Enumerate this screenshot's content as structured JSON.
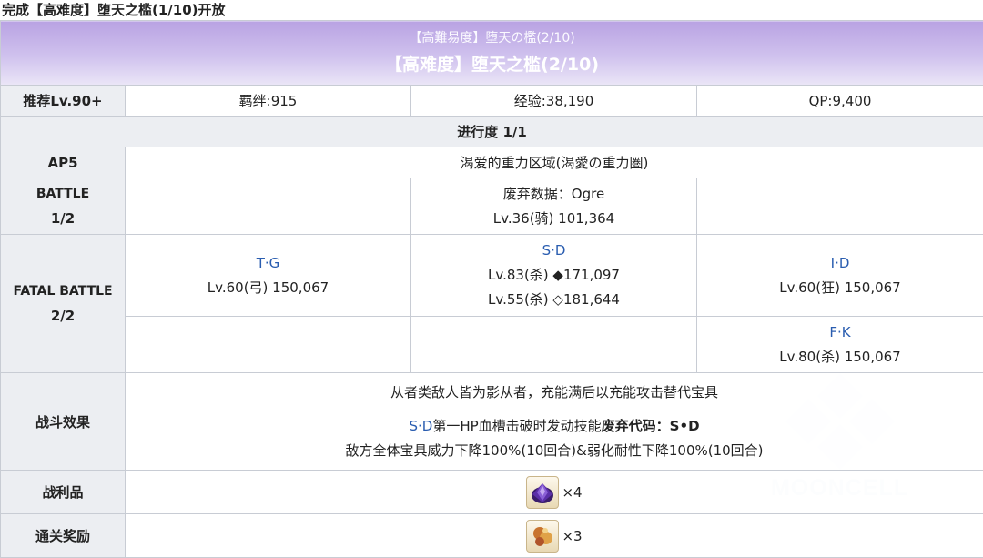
{
  "page_note": "完成【高难度】堕天之槛(1/10)开放",
  "quest": {
    "title_jp": "【高難易度】堕天の檻(2/10)",
    "title_cn": "【高难度】堕天之槛(2/10)",
    "recommend": "推荐Lv.90+",
    "bond": "羁绊:915",
    "exp": "经验:38,190",
    "qp": "QP:9,400",
    "progress": "进行度 1/1",
    "ap": "AP5",
    "field": "渴爱的重力区域(渴愛の重力圏)"
  },
  "battle1": {
    "label": "BATTLE",
    "index": "1/2",
    "enemy_name": "废弃数据：Ogre",
    "enemy_stats": "Lv.36(骑) 101,364"
  },
  "battle2": {
    "label": "FATAL BATTLE",
    "index": "2/2",
    "left_name": "T·G",
    "left_stats": "Lv.60(弓) 150,067",
    "mid_name": "S·D",
    "mid_stats_1": "Lv.83(杀) ◆171,097",
    "mid_stats_2": "Lv.55(杀) ◇181,644",
    "right_name": "I·D",
    "right_stats": "Lv.60(狂) 150,067",
    "right2_name": "F·K",
    "right2_stats": "Lv.80(杀) 150,067"
  },
  "effects": {
    "label": "战斗效果",
    "line1": "从者类敌人皆为影从者，充能满后以充能攻击替代宝具",
    "line2_prefix": "S·D",
    "line2_mid": "第一HP血槽击破时发动技能",
    "line2_bold": "废弃代码：S•D",
    "line3": "敌方全体宝具威力下降100%(10回合)&弱化耐性下降100%(10回合)"
  },
  "drops": {
    "label": "战利品",
    "count": "×4",
    "icon": "purple-gem-icon"
  },
  "rewards": {
    "label": "通关奖励",
    "count": "×3",
    "icon": "gold-ember-icon"
  },
  "watermark": "MOONCELL",
  "colors": {
    "banner": "#b9a3e3",
    "link_blue": "#2a5db0",
    "header_bg": "#eceef2",
    "border": "#c8ccd4"
  }
}
